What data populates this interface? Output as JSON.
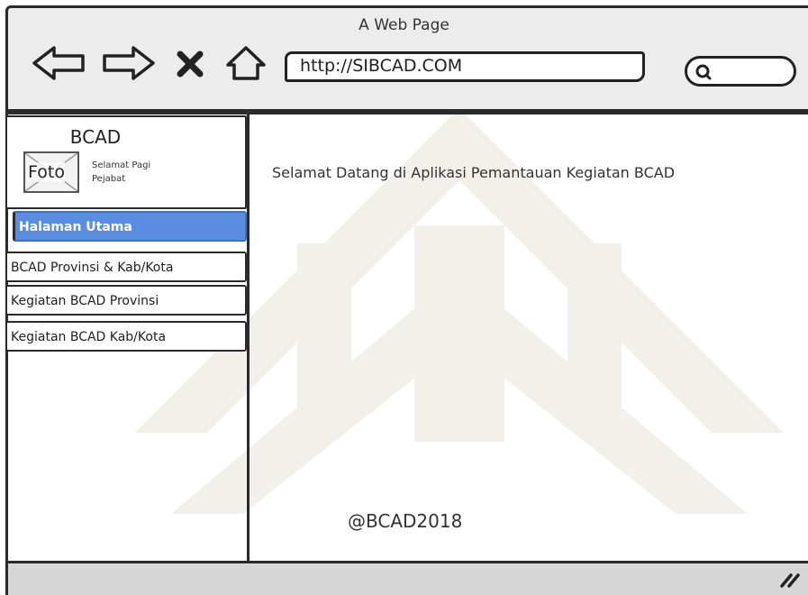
{
  "window": {
    "title": "A Web Page"
  },
  "toolbar": {
    "back_icon": "arrow-left-icon",
    "forward_icon": "arrow-right-icon",
    "stop_icon": "close-icon",
    "home_icon": "home-icon",
    "search_icon": "search-icon"
  },
  "address_bar": {
    "url": "http://SIBCAD.COM"
  },
  "sidebar": {
    "profile": {
      "title": "BCAD",
      "photo_label": "Foto",
      "greeting_line1": "Selamat Pagi",
      "greeting_line2": "Pejabat"
    },
    "items": [
      {
        "label": "Halaman Utama",
        "active": true
      },
      {
        "label": "BCAD Provinsi & Kab/Kota",
        "active": false
      },
      {
        "label": "Kegiatan BCAD Provinsi",
        "active": false
      },
      {
        "label": "Kegiatan BCAD Kab/Kota",
        "active": false
      }
    ]
  },
  "main": {
    "welcome": "Selamat Datang di Aplikasi Pemantauan Kegiatan BCAD",
    "footer": "@BCAD2018"
  },
  "colors": {
    "accent": "#5a8de0",
    "chrome": "#ececec",
    "border": "#2b2b2b"
  }
}
